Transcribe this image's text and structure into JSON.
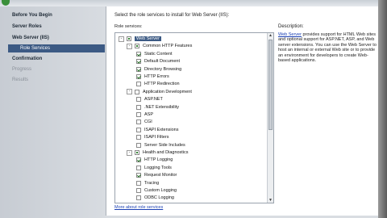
{
  "nav": {
    "items": [
      {
        "label": "Before You Begin"
      },
      {
        "label": "Server Roles"
      },
      {
        "label": "Web Server (IIS)"
      },
      {
        "label": "Role Services"
      },
      {
        "label": "Confirmation"
      },
      {
        "label": "Progress"
      },
      {
        "label": "Results"
      }
    ]
  },
  "main": {
    "instruction": "Select the role services to install for Web Server (IIS):",
    "role_services_label": "Role services:",
    "more_link": "More about role services"
  },
  "tree": {
    "items": [
      {
        "label": "Web Server",
        "state": "partial",
        "expander": "-"
      },
      {
        "label": "Common HTTP Features",
        "state": "partial",
        "expander": "-"
      },
      {
        "label": "Static Content",
        "state": "checked"
      },
      {
        "label": "Default Document",
        "state": "checked"
      },
      {
        "label": "Directory Browsing",
        "state": "checked"
      },
      {
        "label": "HTTP Errors",
        "state": "checked"
      },
      {
        "label": "HTTP Redirection",
        "state": "unchecked"
      },
      {
        "label": "Application Development",
        "state": "unchecked",
        "expander": "-"
      },
      {
        "label": "ASP.NET",
        "state": "unchecked"
      },
      {
        "label": ".NET Extensibility",
        "state": "unchecked"
      },
      {
        "label": "ASP",
        "state": "unchecked"
      },
      {
        "label": "CGI",
        "state": "unchecked"
      },
      {
        "label": "ISAPI Extensions",
        "state": "unchecked"
      },
      {
        "label": "ISAPI Filters",
        "state": "unchecked"
      },
      {
        "label": "Server Side Includes",
        "state": "unchecked"
      },
      {
        "label": "Health and Diagnostics",
        "state": "partial",
        "expander": "-"
      },
      {
        "label": "HTTP Logging",
        "state": "checked"
      },
      {
        "label": "Logging Tools",
        "state": "unchecked"
      },
      {
        "label": "Request Monitor",
        "state": "checked"
      },
      {
        "label": "Tracing",
        "state": "unchecked"
      },
      {
        "label": "Custom Logging",
        "state": "unchecked"
      },
      {
        "label": "ODBC Logging",
        "state": "unchecked"
      }
    ]
  },
  "description": {
    "title": "Description:",
    "link": "Web Server",
    "text": " provides support for HTML Web sites and optional support for ASP.NET, ASP, and Web server extensions. You can use the Web Server to host an internal or external Web site or to provide an environment for developers to create Web-based applications."
  },
  "colors": {
    "selection": "#3c5a84",
    "link": "#1a3fb3",
    "nav_bg": "#d0d5db"
  }
}
